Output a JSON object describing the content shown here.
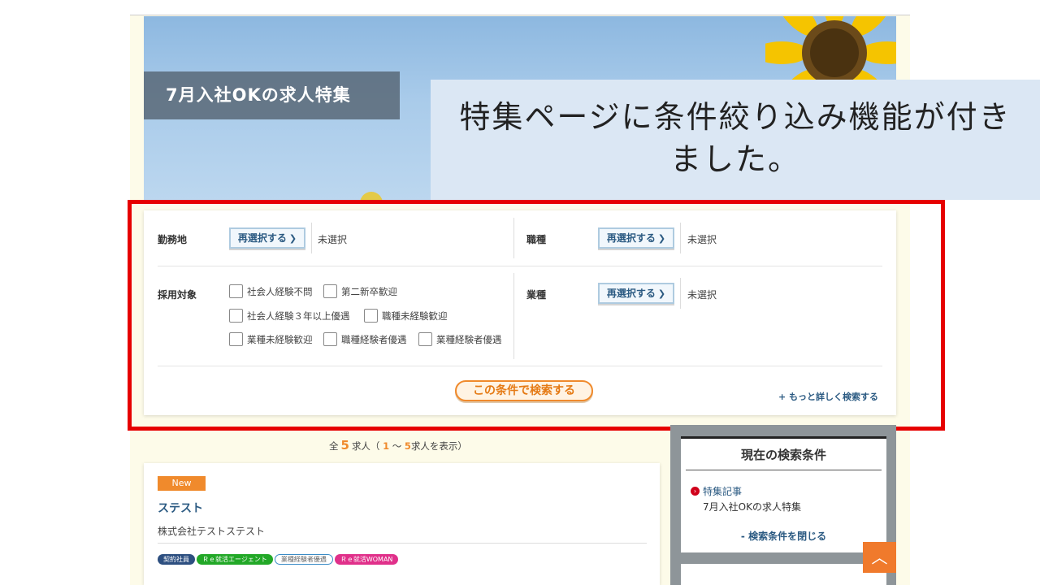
{
  "hero": {
    "title": "7月入社OKの求人特集"
  },
  "callout": {
    "line1": "特集ページに条件絞り込み機能が付き",
    "line2": "ました。"
  },
  "filter": {
    "location": {
      "label": "勤務地",
      "button": "再選択する",
      "value": "未選択"
    },
    "job_type": {
      "label": "職種",
      "button": "再選択する",
      "value": "未選択"
    },
    "industry": {
      "label": "業種",
      "button": "再選択する",
      "value": "未選択"
    },
    "hiring_target": {
      "label": "採用対象",
      "options": [
        "社会人経験不問",
        "第二新卒歓迎",
        "社会人経験３年以上優遇",
        "職種未経験歓迎",
        "業種未経験歓迎",
        "職種経験者優遇",
        "業種経験者優遇"
      ]
    },
    "search_button": "この条件で検索する",
    "more_link": "+ もっと詳しく検索する"
  },
  "results": {
    "prefix": "全",
    "total": "5",
    "unit": "求人（",
    "from": "1",
    "tilde": "〜",
    "to": "5",
    "suffix": "求人を表示）"
  },
  "job": {
    "badge": "New",
    "title": "ステスト",
    "company": "株式会社テストステスト",
    "tags": [
      "契約社員",
      "Ｒｅ就活エージェント",
      "業種経験者優遇",
      "Ｒｅ就活WOMAN"
    ]
  },
  "sidebar": {
    "title": "現在の検索条件",
    "item": "特集記事",
    "item_value": "7月入社OKの求人特集",
    "close": "- 検索条件を閉じる"
  },
  "colors": {
    "accent": "#f08a2c",
    "link": "#2b5a82",
    "highlight_frame": "#e60000"
  },
  "icons": {
    "reselect": "chevron-right-icon",
    "page_top": "chevron-up-icon",
    "sidebar_bullet": "arrow-circle-icon"
  }
}
